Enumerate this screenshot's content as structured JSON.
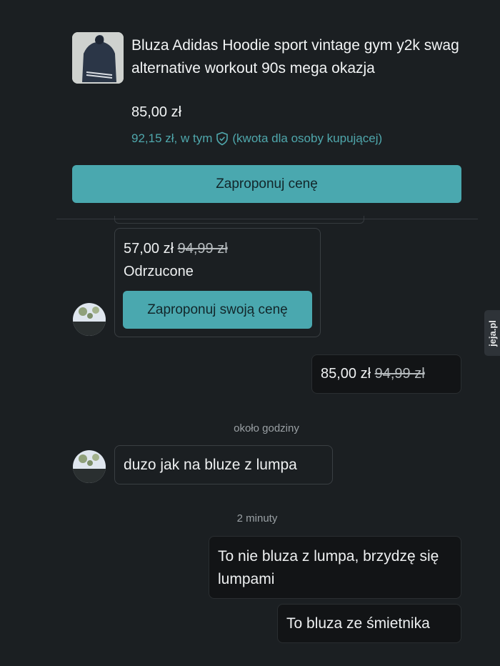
{
  "product": {
    "title": "Bluza Adidas Hoodie sport vintage gym y2k swag alternative workout 90s mega okazja",
    "price": "85,00 zł",
    "buyer_price_prefix": "92,15 zł, w tym",
    "buyer_price_suffix": "(kwota dla osoby kupującej)",
    "offer_button": "Zaproponuj cenę"
  },
  "offer_card": {
    "price": "57,00 zł",
    "old_price": "94,99 zł",
    "status": "Odrzucone",
    "button": "Zaproponuj swoją cenę"
  },
  "messages": {
    "my_offer_price": "85,00 zł",
    "my_offer_old_price": "94,99 zł",
    "time1": "około godziny",
    "seller_msg": "duzo jak na bluze z lumpa",
    "time2": "2 minuty",
    "reply1": "To nie bluza z lumpa, brzydzę się lumpami",
    "reply2": "To bluza ze śmietnika"
  },
  "watermark": {
    "text": "jeja.pl"
  },
  "icons": {
    "shield": "shield-check-icon"
  },
  "colors": {
    "accent": "#4aa8af",
    "background": "#1b1f22"
  }
}
